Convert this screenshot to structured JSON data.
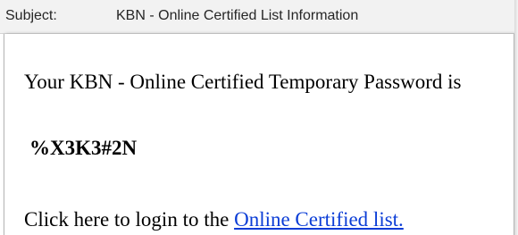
{
  "subject": {
    "label": "Subject:",
    "value": "KBN - Online Certified List Information"
  },
  "message": {
    "intro": "Your KBN - Online Certified Temporary Password is",
    "password": "%X3K3#2N",
    "login_prefix": "Click here to login to the ",
    "login_link": "Online Certified list."
  },
  "colors": {
    "link": "#0a3cd6",
    "subject_bar": "#f2f2f2"
  }
}
